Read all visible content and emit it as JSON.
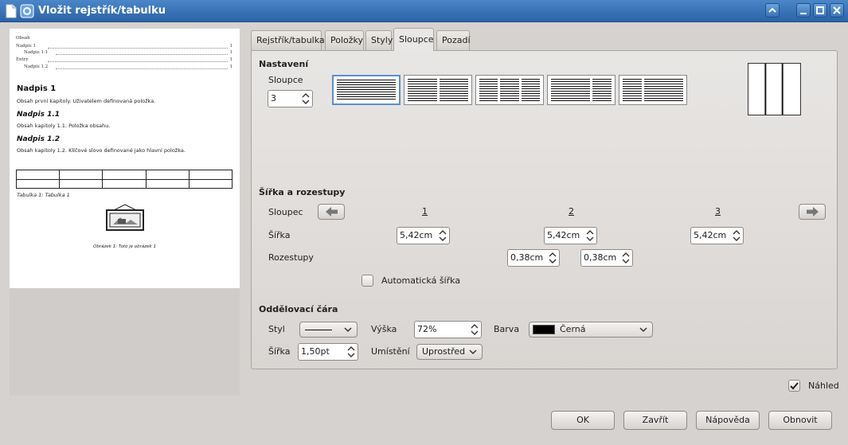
{
  "window": {
    "title": "Vložit rejstřík/tabulku"
  },
  "preview": {
    "toc_title": "Obsah",
    "toc_entries": [
      {
        "text": "Nadpis 1",
        "page": "1"
      },
      {
        "text": "Nadpis 1.1",
        "page": "1"
      },
      {
        "text": "Entry",
        "page": "1"
      },
      {
        "text": "Nadpis 1.2",
        "page": "1"
      }
    ],
    "h1": "Nadpis 1",
    "p1": "Obsah první kapitoly. Uživatelem definovaná položka.",
    "h2a": "Nadpis 1.1",
    "p2": "Obsah kapitoly 1.1. Položka obsahu.",
    "h2b": "Nadpis 1.2",
    "p3": "Obsah kapitoly 1.2. Klíčové slovo definované jako hlavní položka.",
    "table_caption": "Tabulka 1: Tabulka 1",
    "picture_caption": "Obrázek 1: Toto je obrázek 1"
  },
  "tabs": [
    {
      "label": "Rejstřík/tabulka",
      "active": false
    },
    {
      "label": "Položky",
      "active": false
    },
    {
      "label": "Styly",
      "active": false
    },
    {
      "label": "Sloupce",
      "active": true
    },
    {
      "label": "Pozadí",
      "active": false
    }
  ],
  "settings": {
    "section": "Nastavení",
    "columns_label": "Sloupce",
    "columns_value": "3"
  },
  "width_spacing": {
    "section": "Šířka a rozestupy",
    "column_label": "Sloupec",
    "col_numbers": [
      "1",
      "2",
      "3"
    ],
    "width_label": "Šířka",
    "widths": [
      "5,42cm",
      "5,42cm",
      "5,42cm"
    ],
    "spacing_label": "Rozestupy",
    "spacings": [
      "0,38cm",
      "0,38cm"
    ],
    "auto_width_label": "Automatická šířka"
  },
  "separator": {
    "section": "Oddělovací čára",
    "style_label": "Styl",
    "height_label": "Výška",
    "height_value": "72%",
    "color_label": "Barva",
    "color_value": "Černá",
    "width_label": "Šířka",
    "width_value": "1,50pt",
    "position_label": "Umístění",
    "position_value": "Uprostřed"
  },
  "preview_check": {
    "label": "Náhled",
    "checked": true
  },
  "buttons": {
    "ok": "OK",
    "close": "Zavřít",
    "help": "Nápověda",
    "reset": "Obnovit"
  }
}
